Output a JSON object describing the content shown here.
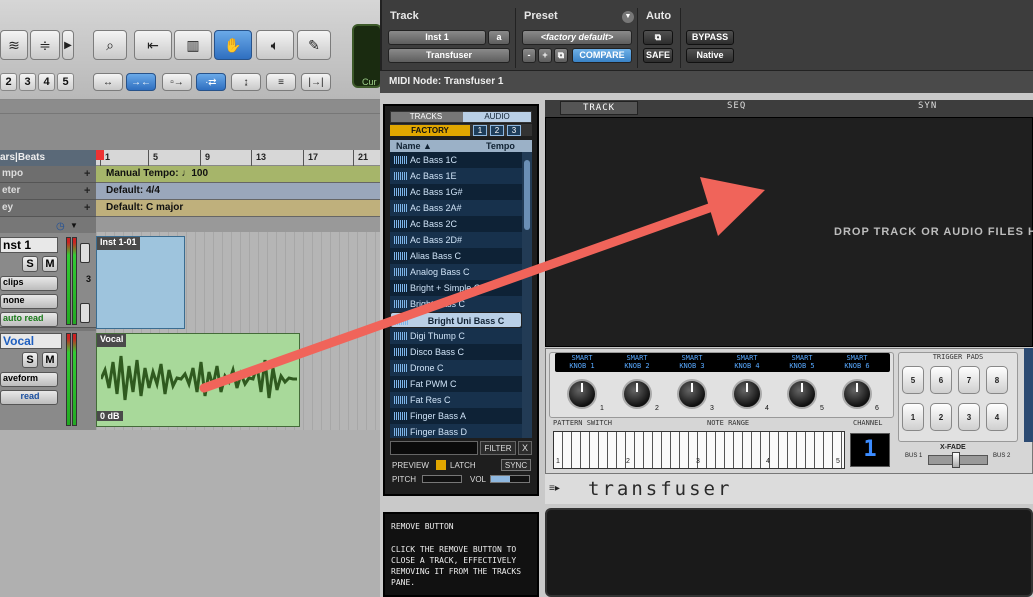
{
  "toolbar": {
    "grid_numbers": [
      "2",
      "3",
      "4",
      "5"
    ],
    "counter_label": "Cur",
    "icons": {
      "zoom": "magnifier-icon",
      "trim": "trim-icon",
      "select": "waveform-select-icon",
      "grabber": "hand-icon",
      "scrub": "speaker-icon",
      "pencil": "pencil-icon"
    }
  },
  "edit": {
    "ruler_label": "ars|Beats",
    "ruler_marks": [
      "1",
      "5",
      "9",
      "13",
      "17",
      "21"
    ],
    "rulers": [
      {
        "label": "mpo",
        "value": "Manual Tempo:",
        "extra": "100"
      },
      {
        "label": "eter",
        "value": "Default: 4/4"
      },
      {
        "label": "ey",
        "value": "Default: C major"
      }
    ],
    "inst_track": {
      "name": "nst 1",
      "m": "M",
      "s": "S",
      "meter_num": "3",
      "playlist": "clips",
      "input": "none",
      "automation": "auto read",
      "clip_name": "Inst 1-01"
    },
    "vocal_track": {
      "name": "Vocal",
      "view": "aveform",
      "automation": "read",
      "m": "M",
      "s": "S",
      "clip_name": "Vocal",
      "clip_gain": "0 dB"
    }
  },
  "plugin": {
    "track_label": "Track",
    "preset_label": "Preset",
    "auto_label": "Auto",
    "track_select": "Inst 1",
    "track_letter": "a",
    "preset_select": "<factory default>",
    "plugin_select": "Transfuser",
    "minus": "-",
    "plus": "+",
    "compare": "COMPARE",
    "bypass": "BYPASS",
    "safe": "SAFE",
    "native": "Native",
    "midi_node": "MIDI Node: Transfuser 1"
  },
  "browser": {
    "tab_tracks": "TRACKS",
    "tab_audio": "AUDIO",
    "factory": "FACTORY",
    "banks": [
      "1",
      "2",
      "3"
    ],
    "col_name": "Name",
    "col_tempo": "Tempo",
    "items": [
      "Ac Bass 1C",
      "Ac Bass 1E",
      "Ac Bass 1G#",
      "Ac Bass 2A#",
      "Ac Bass 2C",
      "Ac Bass 2D#",
      "Alias Bass C",
      "Analog Bass C",
      "Bright + Simple C",
      "Bright Bass C",
      "Bright Uni Bass C",
      "Digi Thump C",
      "Disco Bass C",
      "Drone C",
      "Fat PWM C",
      "Fat Res C",
      "Finger Bass A",
      "Finger Bass D"
    ],
    "selected_index": 10,
    "filter": "FILTER",
    "clear": "X",
    "preview": "PREVIEW",
    "latch": "LATCH",
    "sync": "SYNC",
    "pitch": "PITCH",
    "vol": "VOL"
  },
  "help": {
    "title": "REMOVE BUTTON",
    "text": "CLICK THE REMOVE BUTTON TO CLOSE A TRACK, EFFECTIVELY REMOVING IT FROM THE TRACKS PANE."
  },
  "main": {
    "tabs": [
      "TRACK",
      "SEQ",
      "SYN"
    ],
    "drop_text": "DROP TRACK OR AUDIO FILES HE",
    "knob_labels": [
      "SMART KNOB 1",
      "SMART KNOB 2",
      "SMART KNOB 3",
      "SMART KNOB 4",
      "SMART KNOB 5",
      "SMART KNOB 6"
    ],
    "knob_numbers": [
      "1",
      "2",
      "3",
      "4",
      "5",
      "6"
    ],
    "pattern_switch": "PATTERN SWITCH",
    "note_range": "NOTE RANGE",
    "channel": "CHANNEL",
    "channel_value": "1",
    "trigger_pads": "TRIGGER PADS",
    "pads": [
      "5",
      "6",
      "7",
      "8",
      "1",
      "2",
      "3",
      "4"
    ],
    "xfade": "X-FADE",
    "bus1": "BUS 1",
    "bus2": "BUS 2",
    "octaves": [
      "1",
      "2",
      "3",
      "4",
      "5"
    ],
    "brand": "transfuser"
  },
  "colors": {
    "arrow": "#f0645a",
    "active_tool": "#3a7fd0",
    "factory": "#e0a600",
    "compare": "#4a93d6"
  }
}
